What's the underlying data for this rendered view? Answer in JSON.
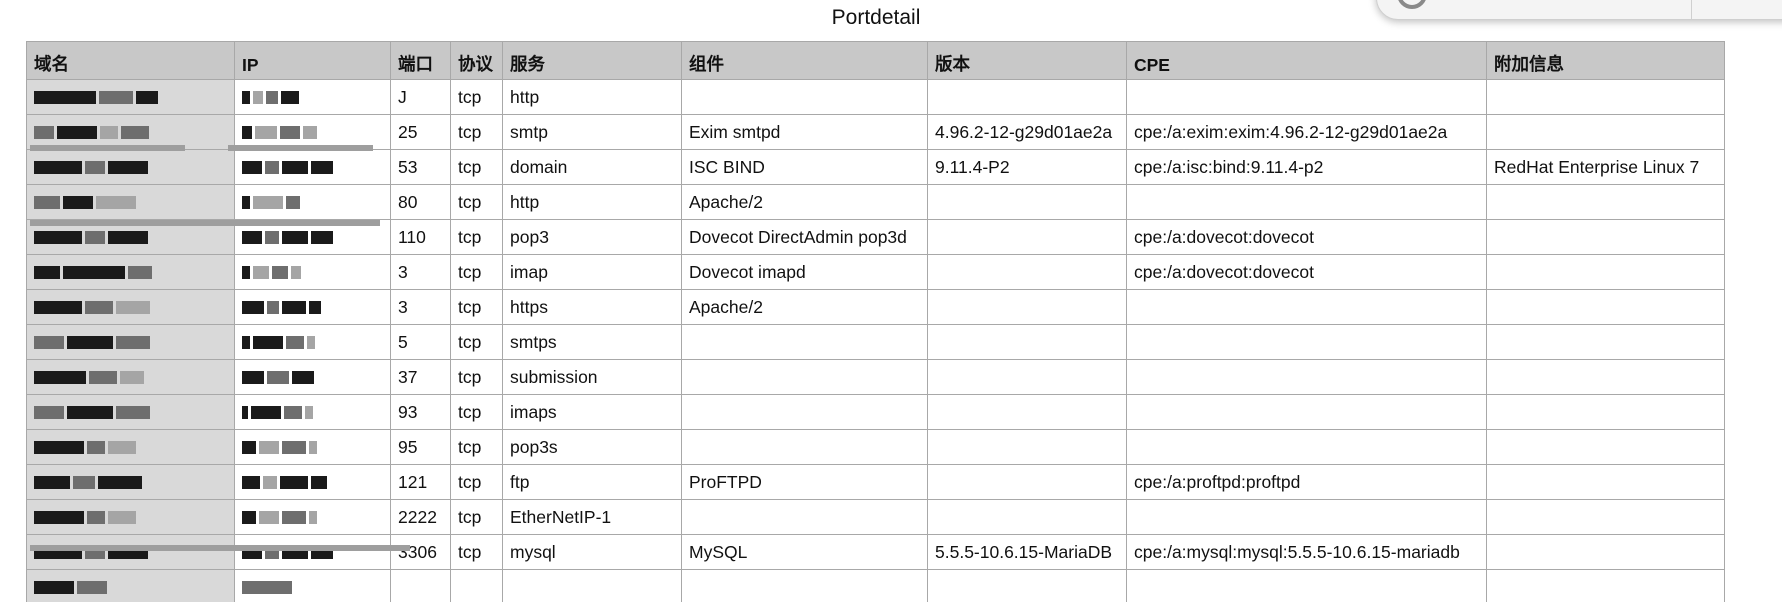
{
  "page": {
    "title": "Portdetail"
  },
  "table": {
    "headers": [
      "域名",
      "IP",
      "端口",
      "协议",
      "服务",
      "组件",
      "版本",
      "CPE",
      "附加信息"
    ],
    "rows": [
      {
        "port": "J",
        "protocol": "tcp",
        "service": "http",
        "component": "",
        "version": "",
        "cpe": "",
        "extra": ""
      },
      {
        "port": "25",
        "protocol": "tcp",
        "service": "smtp",
        "component": "Exim smtpd",
        "version": "4.96.2-12-g29d01ae2a",
        "cpe": "cpe:/a:exim:exim:4.96.2-12-g29d01ae2a",
        "extra": ""
      },
      {
        "port": "53",
        "protocol": "tcp",
        "service": "domain",
        "component": "ISC BIND",
        "version": "9.11.4-P2",
        "cpe": "cpe:/a:isc:bind:9.11.4-p2",
        "extra": "RedHat Enterprise Linux 7"
      },
      {
        "port": "80",
        "protocol": "tcp",
        "service": "http",
        "component": "Apache/2",
        "version": "",
        "cpe": "",
        "extra": ""
      },
      {
        "port": "110",
        "protocol": "tcp",
        "service": "pop3",
        "component": "Dovecot DirectAdmin pop3d",
        "version": "",
        "cpe": "cpe:/a:dovecot:dovecot",
        "extra": ""
      },
      {
        "port": "3",
        "protocol": "tcp",
        "service": "imap",
        "component": "Dovecot imapd",
        "version": "",
        "cpe": "cpe:/a:dovecot:dovecot",
        "extra": ""
      },
      {
        "port": "3",
        "protocol": "tcp",
        "service": "https",
        "component": "Apache/2",
        "version": "",
        "cpe": "",
        "extra": ""
      },
      {
        "port": "5",
        "protocol": "tcp",
        "service": "smtps",
        "component": "",
        "version": "",
        "cpe": "",
        "extra": ""
      },
      {
        "port": "37",
        "protocol": "tcp",
        "service": "submission",
        "component": "",
        "version": "",
        "cpe": "",
        "extra": ""
      },
      {
        "port": "93",
        "protocol": "tcp",
        "service": "imaps",
        "component": "",
        "version": "",
        "cpe": "",
        "extra": ""
      },
      {
        "port": "95",
        "protocol": "tcp",
        "service": "pop3s",
        "component": "",
        "version": "",
        "cpe": "",
        "extra": ""
      },
      {
        "port": "121",
        "protocol": "tcp",
        "service": "ftp",
        "component": "ProFTPD",
        "version": "",
        "cpe": "cpe:/a:proftpd:proftpd",
        "extra": ""
      },
      {
        "port": "2222",
        "protocol": "tcp",
        "service": "EtherNetIP-1",
        "component": "",
        "version": "",
        "cpe": "",
        "extra": ""
      },
      {
        "port": "3306",
        "protocol": "tcp",
        "service": "mysql",
        "component": "MySQL",
        "version": "5.5.5-10.6.15-MariaDB",
        "cpe": "cpe:/a:mysql:mysql:5.5.5-10.6.15-mariadb",
        "extra": ""
      }
    ]
  }
}
